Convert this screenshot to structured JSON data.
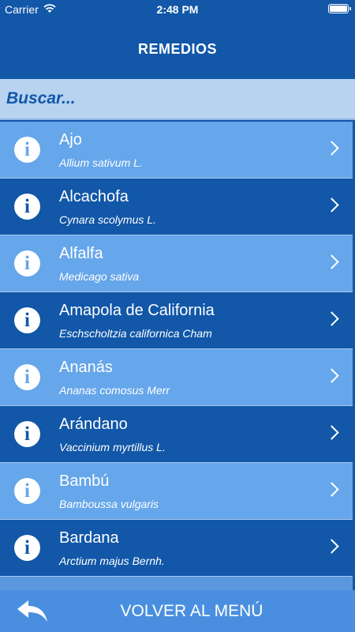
{
  "status_bar": {
    "carrier": "Carrier",
    "time": "2:48 PM",
    "wifi_icon": "wifi-icon",
    "battery_icon": "battery-icon"
  },
  "nav": {
    "title": "REMEDIOS"
  },
  "search": {
    "placeholder": "Buscar..."
  },
  "list": {
    "items": [
      {
        "name": "Ajo",
        "scientific": "Allium sativum L.",
        "style": "light"
      },
      {
        "name": "Alcachofa",
        "scientific": "Cynara scolymus L.",
        "style": "dark"
      },
      {
        "name": "Alfalfa",
        "scientific": "Medicago sativa",
        "style": "light"
      },
      {
        "name": "Amapola de California",
        "scientific": "Eschscholtzia californica Cham",
        "style": "dark"
      },
      {
        "name": "Ananás",
        "scientific": "Ananas comosus Merr",
        "style": "light"
      },
      {
        "name": "Arándano",
        "scientific": "Vaccinium myrtillus L.",
        "style": "dark"
      },
      {
        "name": "Bambú",
        "scientific": "Bamboussa vulgaris",
        "style": "light"
      },
      {
        "name": "Bardana",
        "scientific": "Arctium majus Bernh.",
        "style": "dark"
      }
    ],
    "info_glyph": "i",
    "icons": {
      "info": "info-icon",
      "chevron": "chevron-right-icon"
    }
  },
  "bottom_bar": {
    "label": "VOLVER AL MENÚ",
    "icon": "back-arrow-icon"
  },
  "colors": {
    "primary": "#1257a8",
    "row_light": "#66a6ea",
    "search_bg": "#b7d3f0",
    "bottom_bar": "#4a8fdf"
  }
}
